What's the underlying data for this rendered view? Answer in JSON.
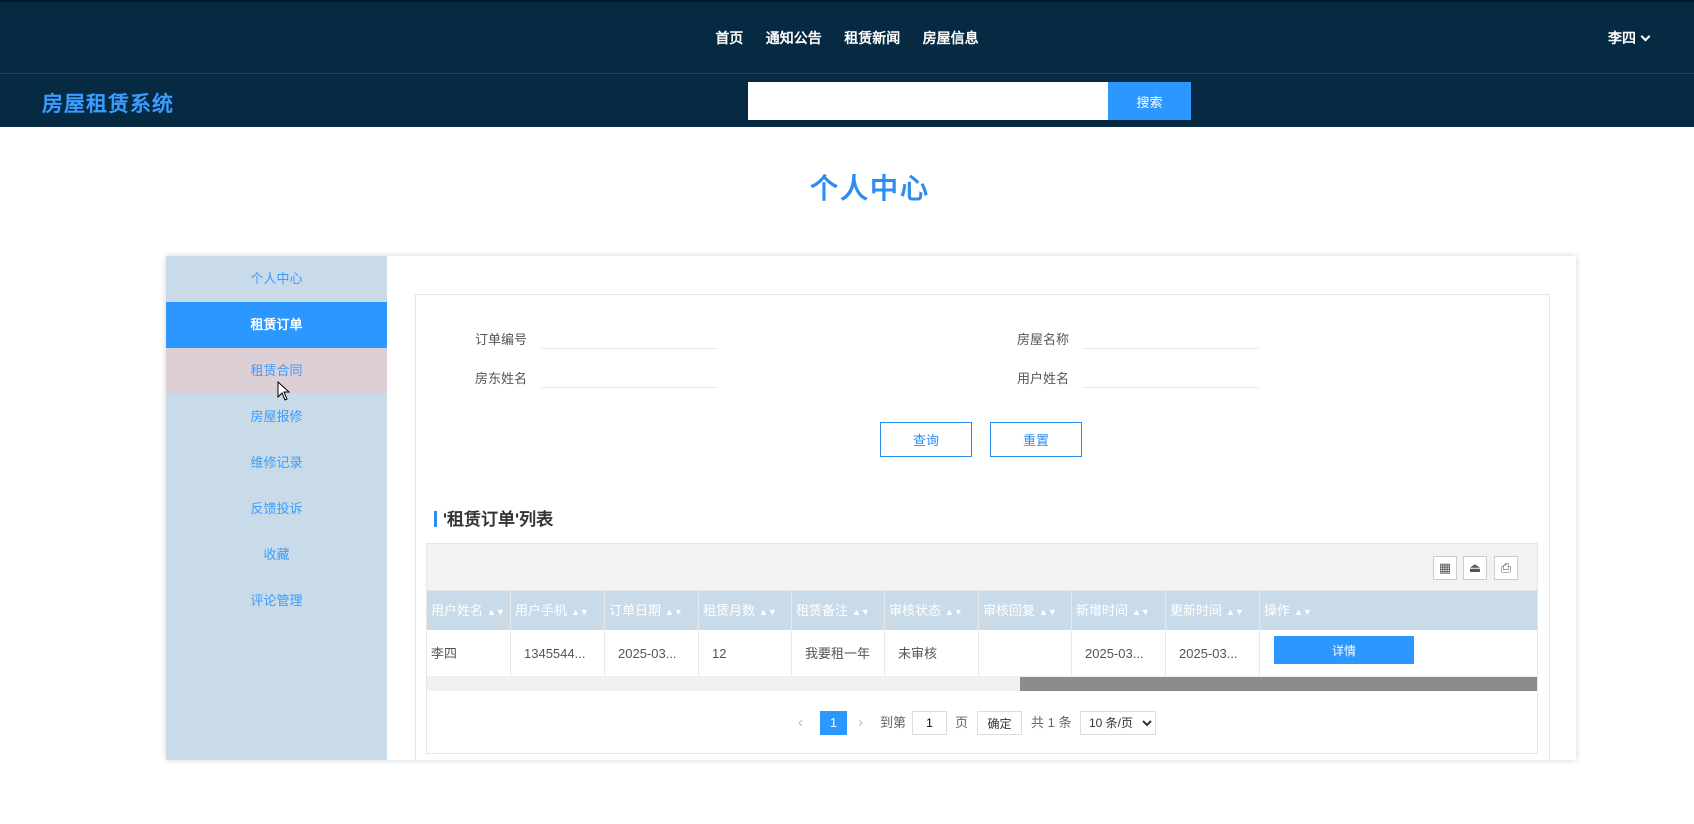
{
  "topnav": {
    "items": [
      "首页",
      "通知公告",
      "租赁新闻",
      "房屋信息"
    ],
    "user": "李四"
  },
  "header": {
    "logo": "房屋租赁系统",
    "search_placeholder": "",
    "search_button": "搜索"
  },
  "page": {
    "title": "个人中心"
  },
  "sidebar": {
    "items": [
      {
        "label": "个人中心"
      },
      {
        "label": "租赁订单"
      },
      {
        "label": "租赁合同"
      },
      {
        "label": "房屋报修"
      },
      {
        "label": "维修记录"
      },
      {
        "label": "反馈投诉"
      },
      {
        "label": "收藏"
      },
      {
        "label": "评论管理"
      }
    ],
    "active": "租赁订单"
  },
  "form": {
    "order_no_label": "订单编号",
    "house_name_label": "房屋名称",
    "landlord_label": "房东姓名",
    "user_name_label": "用户姓名",
    "query_button": "查询",
    "reset_button": "重置"
  },
  "list": {
    "title": "'租赁订单'列表",
    "columns": [
      "用户姓名",
      "用户手机",
      "订单日期",
      "租赁月数",
      "租赁备注",
      "审核状态",
      "审核回复",
      "新增时间",
      "更新时间",
      "操作"
    ],
    "rows": [
      [
        "李四",
        "1345544...",
        "2025-03...",
        "12",
        "我要租一年",
        "未审核",
        "",
        "2025-03...",
        "2025-03..."
      ]
    ],
    "detail_button": "详情"
  },
  "pagination": {
    "current_page": "1",
    "goto_prefix": "到第",
    "goto_value": "1",
    "goto_suffix": "页",
    "confirm": "确定",
    "total": "共 1 条",
    "page_size": "10 条/页"
  },
  "colors": {
    "nav_bg": "#062a42",
    "accent": "#2b97ff",
    "sidebar_bg": "#c9dbe8"
  }
}
